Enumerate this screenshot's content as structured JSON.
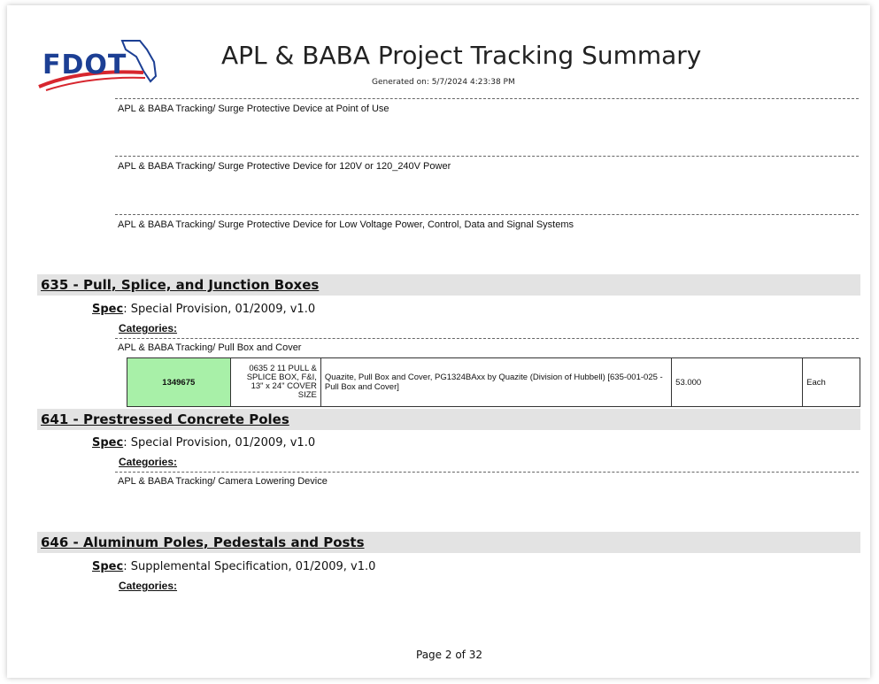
{
  "header": {
    "logo_text": "FDOT",
    "title": "APL & BABA Project Tracking Summary",
    "generated": "Generated on: 5/7/2024 4:23:38 PM"
  },
  "top_categories": [
    "APL & BABA Tracking/ Surge Protective Device at Point of Use",
    "APL & BABA Tracking/ Surge Protective Device for 120V or 120_240V Power",
    "APL & BABA Tracking/ Surge Protective Device for Low Voltage Power, Control, Data and Signal Systems"
  ],
  "sections": [
    {
      "title": "635 - Pull, Splice, and Junction Boxes",
      "spec_label": "Spec",
      "spec_value": ": Special Provision, 01/2009, v1.0",
      "categories_label": "Categories:",
      "category": "APL & BABA Tracking/ Pull Box and Cover",
      "item": {
        "id": "1349675",
        "description": "0635 2 11 PULL & SPLICE BOX, F&I, 13\" x 24\" COVER SIZE",
        "product": "Quazite, Pull Box and Cover, PG1324BAxx by Quazite (Division of Hubbell) [635-001-025 - Pull Box and Cover]",
        "quantity": "53.000",
        "unit": "Each"
      }
    },
    {
      "title": "641 - Prestressed Concrete Poles",
      "spec_label": "Spec",
      "spec_value": ": Special Provision, 01/2009, v1.0",
      "categories_label": "Categories:",
      "category": "APL & BABA Tracking/ Camera Lowering Device"
    },
    {
      "title": "646 - Aluminum Poles, Pedestals and Posts",
      "spec_label": "Spec",
      "spec_value": ": Supplemental Specification, 01/2009, v1.0",
      "categories_label": "Categories:"
    }
  ],
  "footer": {
    "page": "Page 2 of 32"
  },
  "colors": {
    "logo_blue": "#1c3f94",
    "logo_red": "#d7262e",
    "item_highlight": "#a8f0a8",
    "section_bar": "#e3e3e3"
  }
}
